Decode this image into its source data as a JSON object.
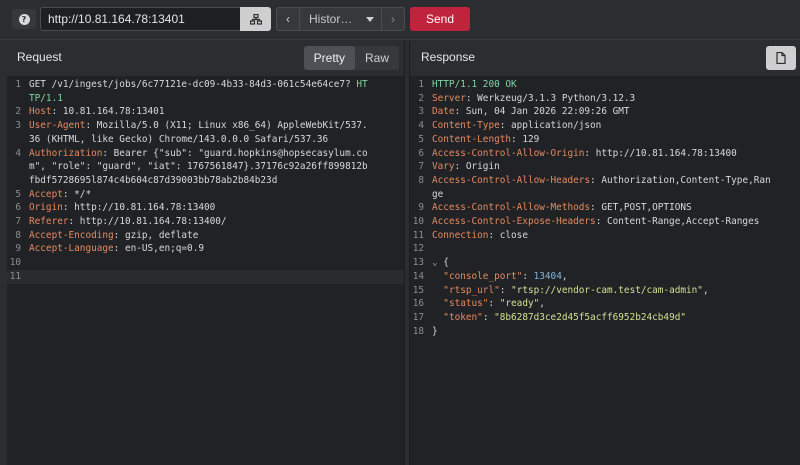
{
  "toolbar": {
    "help_icon": "?",
    "url": "http://10.81.164.78:13401",
    "target_icon": "network-icon",
    "prev_icon": "‹",
    "history_label": "Histor…",
    "next_icon": "›",
    "send_label": "Send"
  },
  "request": {
    "title": "Request",
    "tabs": [
      "Pretty",
      "Raw"
    ],
    "active_tab": "Pretty",
    "lines": [
      {
        "n": "1",
        "segs": [
          [
            "t",
            "GET /v1/ingest/jobs/6c77121e-dc09-4b33-84d3-061c54e64ce7? "
          ],
          [
            "g",
            "HT"
          ]
        ]
      },
      {
        "n": "",
        "segs": [
          [
            "g",
            "TP/1.1"
          ]
        ]
      },
      {
        "n": "2",
        "segs": [
          [
            "k",
            "Host"
          ],
          [
            "t",
            ": 10.81.164.78:13401"
          ]
        ]
      },
      {
        "n": "3",
        "segs": [
          [
            "k",
            "User-Agent"
          ],
          [
            "t",
            ": Mozilla/5.0 (X11; Linux x86_64) AppleWebKit/537."
          ]
        ]
      },
      {
        "n": "",
        "segs": [
          [
            "t",
            "36 (KHTML, like Gecko) Chrome/143.0.0.0 Safari/537.36"
          ]
        ]
      },
      {
        "n": "4",
        "segs": [
          [
            "k",
            "Authorization"
          ],
          [
            "t",
            ": Bearer {\"sub\": \"guard.hopkins@hopsecasylum.co"
          ]
        ]
      },
      {
        "n": "",
        "segs": [
          [
            "t",
            "m\", \"role\": \"guard\", \"iat\": 1767561847}.37176c92a26ff899812b"
          ]
        ]
      },
      {
        "n": "",
        "segs": [
          [
            "t",
            "fbdf5728695l874c4b604c87d39003bb78ab2b84b23d"
          ]
        ]
      },
      {
        "n": "5",
        "segs": [
          [
            "k",
            "Accept"
          ],
          [
            "t",
            ": */*"
          ]
        ]
      },
      {
        "n": "6",
        "segs": [
          [
            "k",
            "Origin"
          ],
          [
            "t",
            ": http://10.81.164.78:13400"
          ]
        ]
      },
      {
        "n": "7",
        "segs": [
          [
            "k",
            "Referer"
          ],
          [
            "t",
            ": http://10.81.164.78:13400/"
          ]
        ]
      },
      {
        "n": "8",
        "segs": [
          [
            "k",
            "Accept-Encoding"
          ],
          [
            "t",
            ": gzip, deflate"
          ]
        ]
      },
      {
        "n": "9",
        "segs": [
          [
            "k",
            "Accept-Language"
          ],
          [
            "t",
            ": en-US,en;q=0.9"
          ]
        ]
      },
      {
        "n": "10",
        "segs": [
          [
            "t",
            ""
          ]
        ]
      },
      {
        "n": "11",
        "segs": [
          [
            "t",
            ""
          ]
        ],
        "hl": true
      }
    ]
  },
  "response": {
    "title": "Response",
    "copy_icon": "document-icon",
    "lines": [
      {
        "n": "1",
        "segs": [
          [
            "g",
            "HTTP/1.1 200 OK"
          ]
        ]
      },
      {
        "n": "2",
        "segs": [
          [
            "k",
            "Server"
          ],
          [
            "t",
            ": Werkzeug/3.1.3 Python/3.12.3"
          ]
        ]
      },
      {
        "n": "3",
        "segs": [
          [
            "k",
            "Date"
          ],
          [
            "t",
            ": Sun, 04 Jan 2026 22:09:26 GMT"
          ]
        ]
      },
      {
        "n": "4",
        "segs": [
          [
            "k",
            "Content-Type"
          ],
          [
            "t",
            ": application/json"
          ]
        ]
      },
      {
        "n": "5",
        "segs": [
          [
            "k",
            "Content-Length"
          ],
          [
            "t",
            ": 129"
          ]
        ]
      },
      {
        "n": "6",
        "segs": [
          [
            "k",
            "Access-Control-Allow-Origin"
          ],
          [
            "t",
            ": http://10.81.164.78:13400"
          ]
        ]
      },
      {
        "n": "7",
        "segs": [
          [
            "k",
            "Vary"
          ],
          [
            "t",
            ": Origin"
          ]
        ]
      },
      {
        "n": "8",
        "segs": [
          [
            "k",
            "Access-Control-Allow-Headers"
          ],
          [
            "t",
            ": Authorization,Content-Type,Ran"
          ]
        ]
      },
      {
        "n": "",
        "segs": [
          [
            "t",
            "ge"
          ]
        ]
      },
      {
        "n": "9",
        "segs": [
          [
            "k",
            "Access-Control-Allow-Methods"
          ],
          [
            "t",
            ": GET,POST,OPTIONS"
          ]
        ]
      },
      {
        "n": "10",
        "segs": [
          [
            "k",
            "Access-Control-Expose-Headers"
          ],
          [
            "t",
            ": Content-Range,Accept-Ranges"
          ]
        ]
      },
      {
        "n": "11",
        "segs": [
          [
            "k",
            "Connection"
          ],
          [
            "t",
            ": close"
          ]
        ]
      },
      {
        "n": "12",
        "segs": [
          [
            "t",
            ""
          ]
        ]
      },
      {
        "n": "13",
        "segs": [
          [
            "f",
            "⌄ "
          ],
          [
            "t",
            "{"
          ]
        ]
      },
      {
        "n": "14",
        "segs": [
          [
            "t",
            "  "
          ],
          [
            "k",
            "\"console_port\""
          ],
          [
            "t",
            ": "
          ],
          [
            "n",
            "13404"
          ],
          [
            "t",
            ","
          ]
        ]
      },
      {
        "n": "15",
        "segs": [
          [
            "t",
            "  "
          ],
          [
            "k",
            "\"rtsp_url\""
          ],
          [
            "t",
            ": "
          ],
          [
            "s",
            "\"rtsp://vendor-cam.test/cam-admin\""
          ],
          [
            "t",
            ","
          ]
        ]
      },
      {
        "n": "16",
        "segs": [
          [
            "t",
            "  "
          ],
          [
            "k",
            "\"status\""
          ],
          [
            "t",
            ": "
          ],
          [
            "s",
            "\"ready\""
          ],
          [
            "t",
            ","
          ]
        ]
      },
      {
        "n": "17",
        "segs": [
          [
            "t",
            "  "
          ],
          [
            "k",
            "\"token\""
          ],
          [
            "t",
            ": "
          ],
          [
            "s",
            "\"8b6287d3ce2d45f5acff6952b24cb49d\""
          ]
        ]
      },
      {
        "n": "18",
        "segs": [
          [
            "t",
            "}"
          ]
        ]
      }
    ]
  }
}
